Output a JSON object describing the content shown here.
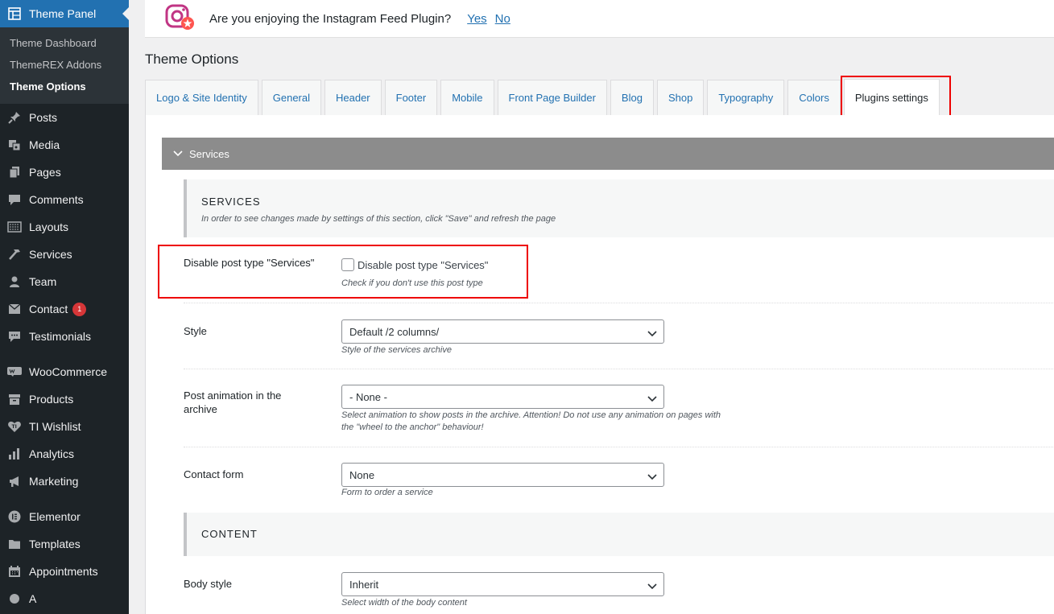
{
  "sidebar": {
    "active": {
      "label": "Theme Panel",
      "icon": "grid-panel-icon"
    },
    "submenu": [
      "Theme Dashboard",
      "ThemeREX Addons",
      "Theme Options"
    ],
    "items": [
      {
        "label": "Posts",
        "icon": "pin-icon"
      },
      {
        "label": "Media",
        "icon": "media-icon"
      },
      {
        "label": "Pages",
        "icon": "pages-icon"
      },
      {
        "label": "Comments",
        "icon": "comment-icon"
      },
      {
        "label": "Layouts",
        "icon": "layout-icon"
      },
      {
        "label": "Services",
        "icon": "hammer-icon"
      },
      {
        "label": "Team",
        "icon": "person-icon"
      },
      {
        "label": "Contact",
        "icon": "envelope-icon",
        "badge": "1"
      },
      {
        "label": "Testimonials",
        "icon": "chat-bubble-icon"
      },
      {
        "label": "WooCommerce",
        "icon": "woo-icon"
      },
      {
        "label": "Products",
        "icon": "archive-icon"
      },
      {
        "label": "TI Wishlist",
        "icon": "heart-icon"
      },
      {
        "label": "Analytics",
        "icon": "bar-chart-icon"
      },
      {
        "label": "Marketing",
        "icon": "megaphone-icon"
      },
      {
        "label": "Elementor",
        "icon": "elementor-icon"
      },
      {
        "label": "Templates",
        "icon": "folder-icon"
      },
      {
        "label": "Appointments",
        "icon": "calendar-icon"
      },
      {
        "label": "A",
        "icon": "misc-icon"
      }
    ]
  },
  "notice": {
    "question": "Are you enjoying the Instagram Feed Plugin?",
    "yes": "Yes",
    "no": "No"
  },
  "page_title": "Theme Options",
  "tabs": [
    "Logo & Site Identity",
    "General",
    "Header",
    "Footer",
    "Mobile",
    "Front Page Builder",
    "Blog",
    "Shop",
    "Typography",
    "Colors",
    "Plugins settings"
  ],
  "section": {
    "title": "Services"
  },
  "services_group": {
    "title": "SERVICES",
    "desc": "In order to see changes made by settings of this section, click \"Save\" and refresh the page"
  },
  "disable_row": {
    "label": "Disable post type \"Services\"",
    "checkbox_label": "Disable post type \"Services\"",
    "desc": "Check if you don't use this post type"
  },
  "style_row": {
    "label": "Style",
    "value": "Default /2 columns/",
    "desc": "Style of the services archive"
  },
  "animation_row": {
    "label": "Post animation in the archive",
    "value": "- None -",
    "desc": "Select animation to show posts in the archive. Attention! Do not use any animation on pages with the \"wheel to the anchor\" behaviour!"
  },
  "contact_row": {
    "label": "Contact form",
    "value": "None",
    "desc": "Form to order a service"
  },
  "content_group": {
    "title": "CONTENT"
  },
  "body_row": {
    "label": "Body style",
    "value": "Inherit",
    "desc": "Select width of the body content"
  },
  "colors": {
    "sidebar_bg": "#1d2327",
    "active_blue": "#2271b1",
    "highlight_red": "#e00000",
    "section_bar": "#8c8c8c"
  }
}
